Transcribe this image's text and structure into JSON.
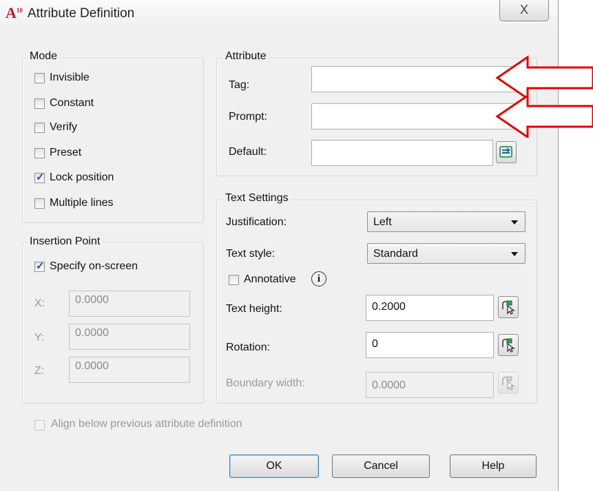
{
  "window": {
    "title": "Attribute Definition",
    "app_icon_text": "A",
    "app_icon_sub": "10",
    "close_glyph": "X"
  },
  "mode": {
    "label": "Mode",
    "items": [
      {
        "label": "Invisible",
        "checked": false
      },
      {
        "label": "Constant",
        "checked": false
      },
      {
        "label": "Verify",
        "checked": false
      },
      {
        "label": "Preset",
        "checked": false
      },
      {
        "label": "Lock position",
        "checked": true
      },
      {
        "label": "Multiple lines",
        "checked": false
      }
    ]
  },
  "insertion": {
    "label": "Insertion Point",
    "specify_label": "Specify on-screen",
    "specify_checked": true,
    "x_label": "X:",
    "x_value": "0.0000",
    "y_label": "Y:",
    "y_value": "0.0000",
    "z_label": "Z:",
    "z_value": "0.0000"
  },
  "attribute": {
    "label": "Attribute",
    "tag_label": "Tag:",
    "tag_value": "",
    "prompt_label": "Prompt:",
    "prompt_value": "",
    "default_label": "Default:",
    "default_value": ""
  },
  "text_settings": {
    "label": "Text Settings",
    "justification_label": "Justification:",
    "justification_value": "Left",
    "style_label": "Text style:",
    "style_value": "Standard",
    "annotative_label": "Annotative",
    "annotative_checked": false,
    "info_glyph": "i",
    "height_label": "Text height:",
    "height_value": "0.2000",
    "rotation_label": "Rotation:",
    "rotation_value": "0",
    "boundary_label": "Boundary width:",
    "boundary_value": "0.0000"
  },
  "align_label": "Align below previous attribute definition",
  "buttons": {
    "ok": "OK",
    "cancel": "Cancel",
    "help": "Help"
  },
  "colors": {
    "arrow": "#e00000",
    "accent": "#3c7fb1"
  }
}
